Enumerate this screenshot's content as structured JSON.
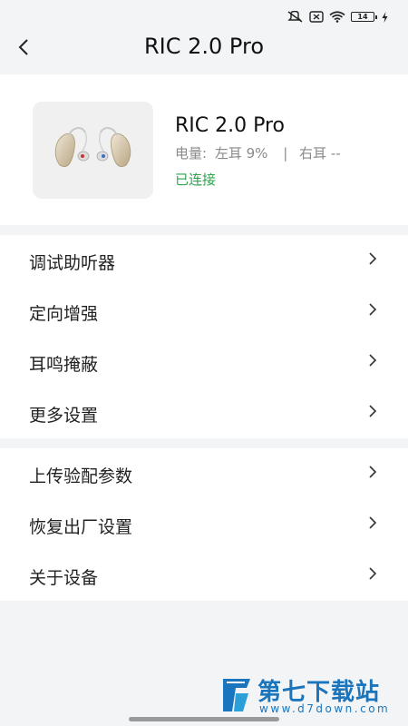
{
  "status_bar": {
    "battery_level": "14",
    "icons": [
      "mute-vibrate-icon",
      "sim-off-icon",
      "wifi-icon",
      "battery-icon",
      "charging-icon"
    ]
  },
  "header": {
    "title": "RIC 2.0 Pro",
    "back_icon": "chevron-left-icon"
  },
  "device": {
    "name": "RIC 2.0 Pro",
    "battery_label": "电量:",
    "left_ear": "左耳 9%",
    "separator": "|",
    "right_ear": "右耳 --",
    "connection": "已连接",
    "connection_color": "#2fa44f"
  },
  "menu_group_1": [
    {
      "label": "调试助听器"
    },
    {
      "label": "定向增强"
    },
    {
      "label": "耳鸣掩蔽"
    },
    {
      "label": "更多设置"
    }
  ],
  "menu_group_2": [
    {
      "label": "上传验配参数"
    },
    {
      "label": "恢复出厂设置"
    },
    {
      "label": "关于设备"
    }
  ],
  "watermark": {
    "title": "第七下载站",
    "url": "www.d7down.com",
    "color": "#1b75bc"
  }
}
